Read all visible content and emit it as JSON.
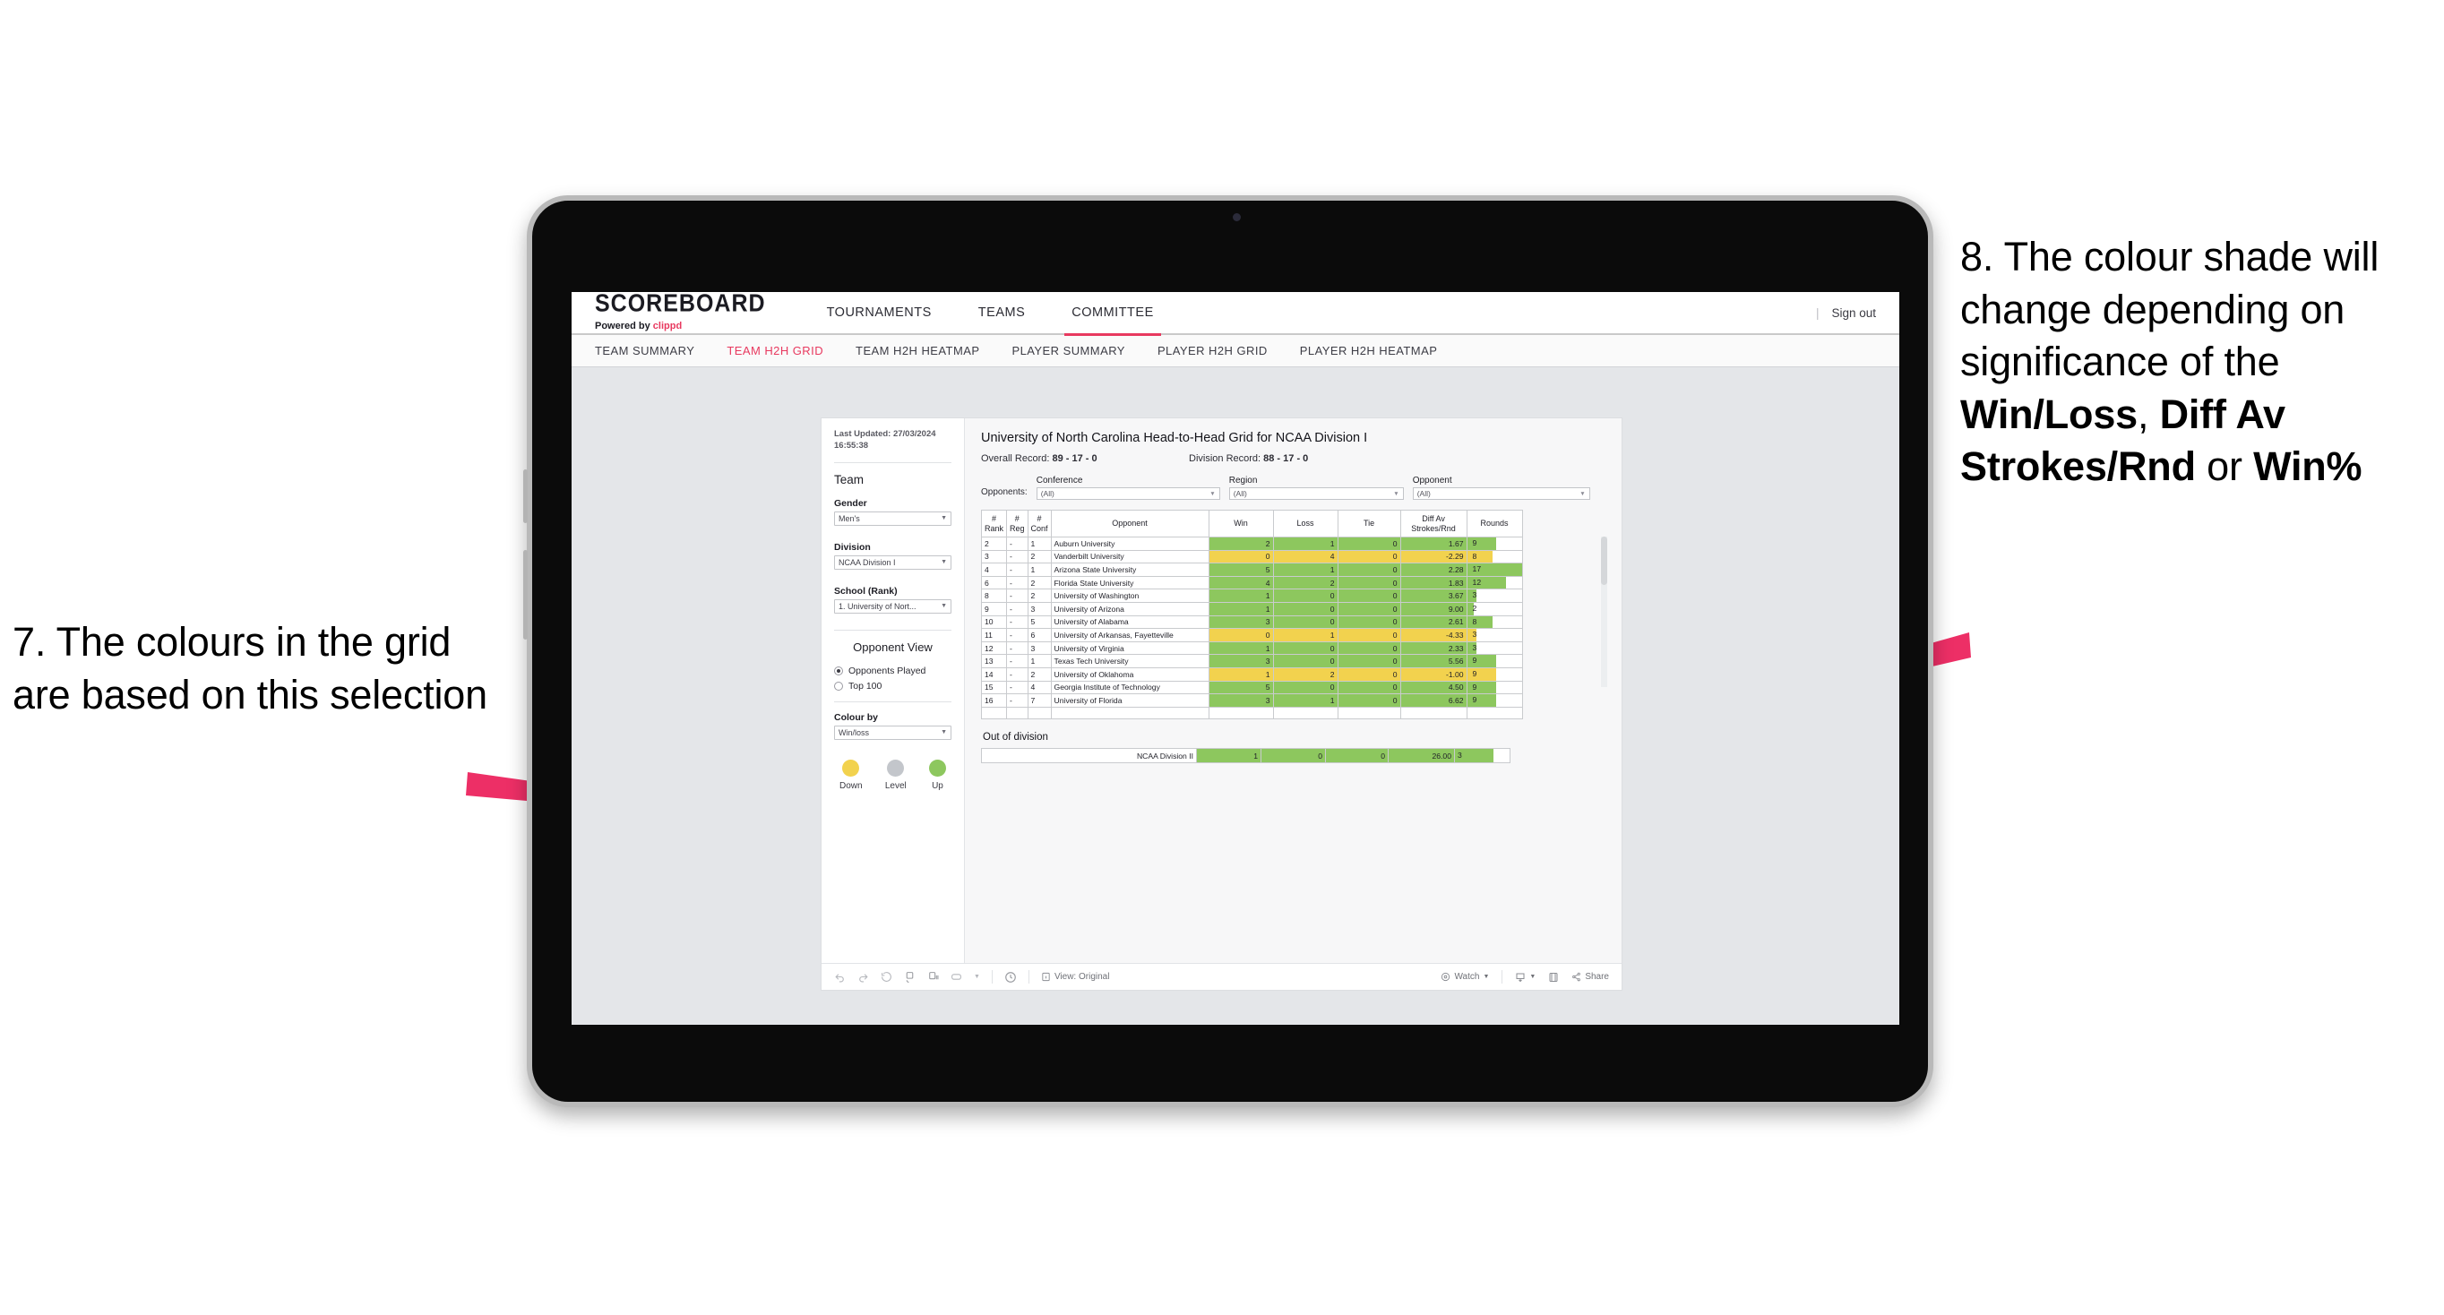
{
  "annotations": {
    "left": {
      "id": "callout-7",
      "text": "7. The colours in the grid are based on this selection"
    },
    "right": {
      "id": "callout-8",
      "prefix": "8. The colour shade will change depending on significance of the ",
      "bold1": "Win/Loss",
      "mid1": ", ",
      "bold2": "Diff Av Strokes/Rnd",
      "mid2": " or ",
      "bold3": "Win%"
    },
    "arrow_color": "#ed2f66"
  },
  "browser": {
    "topnav": {
      "brand_title": "SCOREBOARD",
      "brand_sub_prefix": "Powered by ",
      "brand_sub_brand": "clippd",
      "tabs": [
        {
          "label": "TOURNAMENTS",
          "active": false
        },
        {
          "label": "TEAMS",
          "active": false
        },
        {
          "label": "COMMITTEE",
          "active": true
        }
      ],
      "separator": "|",
      "signout": "Sign out"
    },
    "subnav": {
      "tabs": [
        {
          "label": "TEAM SUMMARY",
          "active": false
        },
        {
          "label": "TEAM H2H GRID",
          "active": true
        },
        {
          "label": "TEAM H2H HEATMAP",
          "active": false
        },
        {
          "label": "PLAYER SUMMARY",
          "active": false
        },
        {
          "label": "PLAYER H2H GRID",
          "active": false
        },
        {
          "label": "PLAYER H2H HEATMAP",
          "active": false
        }
      ]
    }
  },
  "sidebar": {
    "last_updated": "Last Updated: 27/03/2024 16:55:38",
    "team_heading": "Team",
    "fields": [
      {
        "label": "Gender",
        "value": "Men's"
      },
      {
        "label": "Division",
        "value": "NCAA Division I"
      },
      {
        "label": "School (Rank)",
        "value": "1. University of Nort..."
      }
    ],
    "opponent_view": {
      "heading": "Opponent View",
      "options": [
        {
          "label": "Opponents Played",
          "selected": true
        },
        {
          "label": "Top 100",
          "selected": false
        }
      ]
    },
    "colour_by": {
      "label": "Colour by",
      "value": "Win/loss"
    },
    "legend": [
      {
        "label": "Down",
        "color": "#f2d24e"
      },
      {
        "label": "Level",
        "color": "#c3c6cb"
      },
      {
        "label": "Up",
        "color": "#8dc75e"
      }
    ]
  },
  "main": {
    "title": "University of North Carolina Head-to-Head Grid for NCAA Division I",
    "records": [
      {
        "label": "Overall Record: ",
        "value": "89 - 17 - 0"
      },
      {
        "label": "Division Record: ",
        "value": "88 - 17 - 0"
      }
    ],
    "opponents_label": "Opponents:",
    "filters": [
      {
        "label": "Conference",
        "value": "(All)"
      },
      {
        "label": "Region",
        "value": "(All)"
      },
      {
        "label": "Opponent",
        "value": "(All)"
      }
    ],
    "out_of_division_title": "Out of division",
    "out_of_division_row": {
      "name": "NCAA Division II",
      "win": "1",
      "loss": "0",
      "tie": "0",
      "diff": "26.00",
      "rounds": "3",
      "state": "up"
    }
  },
  "chart_data": {
    "type": "table",
    "title": "University of North Carolina Head-to-Head Grid for NCAA Division I",
    "columns": [
      "# Rank",
      "# Reg",
      "# Conf",
      "Opponent",
      "Win",
      "Loss",
      "Tie",
      "Diff Av Strokes/Rnd",
      "Rounds"
    ],
    "column_headers_multiline": [
      [
        "#",
        "Rank"
      ],
      [
        "#",
        "Reg"
      ],
      [
        "#",
        "Conf"
      ],
      [
        "Opponent"
      ],
      [
        "Win"
      ],
      [
        "Loss"
      ],
      [
        "Tie"
      ],
      [
        "Diff Av",
        "Strokes/Rnd"
      ],
      [
        "Rounds"
      ]
    ],
    "colour_by": "Win/loss",
    "colour_scale": {
      "up": "#8dc75e",
      "down": "#f2d24e",
      "level": "#c3c6cb"
    },
    "rounds_max": 17,
    "rows": [
      {
        "rank": "2",
        "reg": "-",
        "conf": "1",
        "opponent": "Auburn University",
        "win": "2",
        "loss": "1",
        "tie": "0",
        "diff": "1.67",
        "rounds": "9",
        "state": "up"
      },
      {
        "rank": "3",
        "reg": "-",
        "conf": "2",
        "opponent": "Vanderbilt University",
        "win": "0",
        "loss": "4",
        "tie": "0",
        "diff": "-2.29",
        "rounds": "8",
        "state": "down"
      },
      {
        "rank": "4",
        "reg": "-",
        "conf": "1",
        "opponent": "Arizona State University",
        "win": "5",
        "loss": "1",
        "tie": "0",
        "diff": "2.28",
        "rounds": "17",
        "state": "up"
      },
      {
        "rank": "6",
        "reg": "-",
        "conf": "2",
        "opponent": "Florida State University",
        "win": "4",
        "loss": "2",
        "tie": "0",
        "diff": "1.83",
        "rounds": "12",
        "state": "up"
      },
      {
        "rank": "8",
        "reg": "-",
        "conf": "2",
        "opponent": "University of Washington",
        "win": "1",
        "loss": "0",
        "tie": "0",
        "diff": "3.67",
        "rounds": "3",
        "state": "up"
      },
      {
        "rank": "9",
        "reg": "-",
        "conf": "3",
        "opponent": "University of Arizona",
        "win": "1",
        "loss": "0",
        "tie": "0",
        "diff": "9.00",
        "rounds": "2",
        "state": "up"
      },
      {
        "rank": "10",
        "reg": "-",
        "conf": "5",
        "opponent": "University of Alabama",
        "win": "3",
        "loss": "0",
        "tie": "0",
        "diff": "2.61",
        "rounds": "8",
        "state": "up"
      },
      {
        "rank": "11",
        "reg": "-",
        "conf": "6",
        "opponent": "University of Arkansas, Fayetteville",
        "win": "0",
        "loss": "1",
        "tie": "0",
        "diff": "-4.33",
        "rounds": "3",
        "state": "down"
      },
      {
        "rank": "12",
        "reg": "-",
        "conf": "3",
        "opponent": "University of Virginia",
        "win": "1",
        "loss": "0",
        "tie": "0",
        "diff": "2.33",
        "rounds": "3",
        "state": "up"
      },
      {
        "rank": "13",
        "reg": "-",
        "conf": "1",
        "opponent": "Texas Tech University",
        "win": "3",
        "loss": "0",
        "tie": "0",
        "diff": "5.56",
        "rounds": "9",
        "state": "up"
      },
      {
        "rank": "14",
        "reg": "-",
        "conf": "2",
        "opponent": "University of Oklahoma",
        "win": "1",
        "loss": "2",
        "tie": "0",
        "diff": "-1.00",
        "rounds": "9",
        "state": "down"
      },
      {
        "rank": "15",
        "reg": "-",
        "conf": "4",
        "opponent": "Georgia Institute of Technology",
        "win": "5",
        "loss": "0",
        "tie": "0",
        "diff": "4.50",
        "rounds": "9",
        "state": "up"
      },
      {
        "rank": "16",
        "reg": "-",
        "conf": "7",
        "opponent": "University of Florida",
        "win": "3",
        "loss": "1",
        "tie": "0",
        "diff": "6.62",
        "rounds": "9",
        "state": "up"
      }
    ]
  },
  "toolbar": {
    "view_label": "View: Original",
    "watch_label": "Watch",
    "share_label": "Share"
  }
}
